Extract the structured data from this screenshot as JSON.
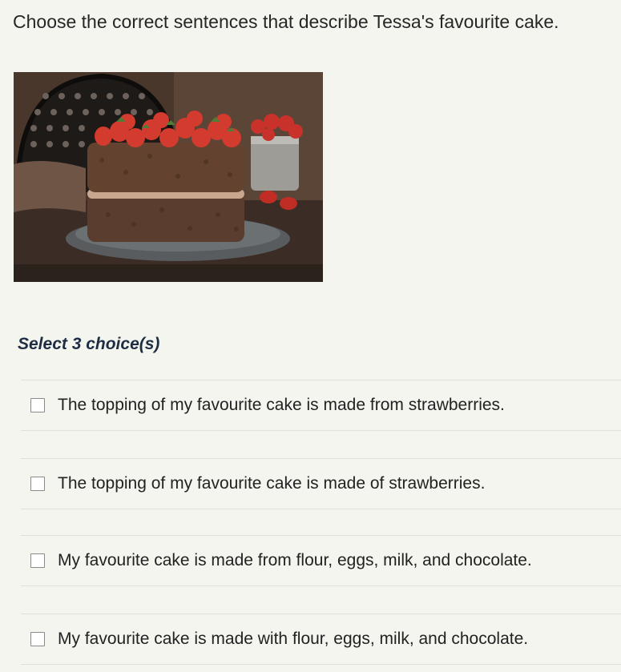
{
  "question": {
    "text": "Choose the correct sentences that describe Tessa's favourite cake."
  },
  "image": {
    "alt_icon": "chocolate-cake-with-strawberries-photo"
  },
  "select": {
    "label": "Select 3 choice(s)"
  },
  "choices": [
    {
      "label": "The topping of my favourite cake is made from strawberries.",
      "checked": false
    },
    {
      "label": "The topping of my favourite cake is made of strawberries.",
      "checked": false
    },
    {
      "label": "My favourite cake is made from flour, eggs, milk, and chocolate.",
      "checked": false
    },
    {
      "label": "My favourite cake is made with flour, eggs, milk, and chocolate.",
      "checked": false
    }
  ]
}
